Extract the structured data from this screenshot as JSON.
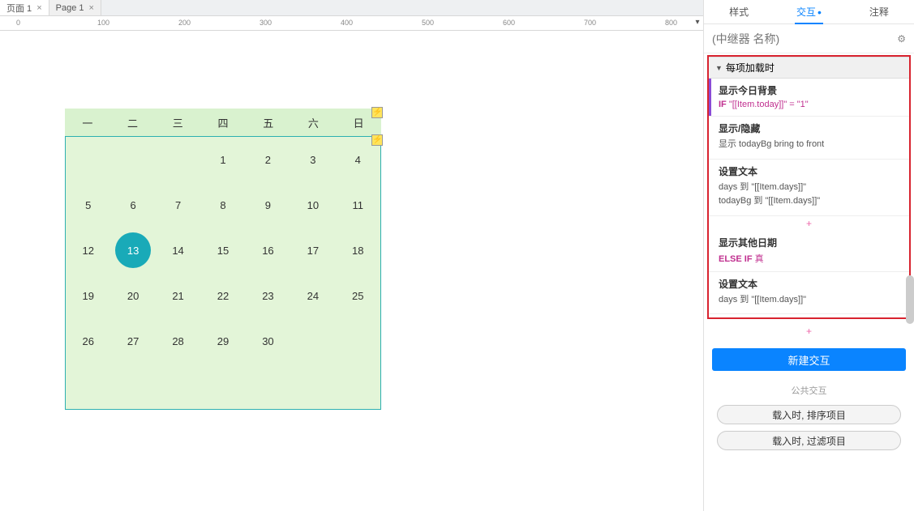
{
  "doc_tabs": [
    {
      "label": "页面 1",
      "active": true
    },
    {
      "label": "Page 1",
      "active": false
    }
  ],
  "ruler_ticks": [
    0,
    100,
    200,
    300,
    400,
    500,
    600,
    700,
    800
  ],
  "calendar": {
    "weekdays": [
      "一",
      "二",
      "三",
      "四",
      "五",
      "六",
      "日"
    ],
    "cells": [
      "",
      "",
      "",
      "1",
      "2",
      "3",
      "4",
      "5",
      "6",
      "7",
      "8",
      "9",
      "10",
      "11",
      "12",
      "13",
      "14",
      "15",
      "16",
      "17",
      "18",
      "19",
      "20",
      "21",
      "22",
      "23",
      "24",
      "25",
      "26",
      "27",
      "28",
      "29",
      "30",
      "",
      "",
      "",
      "",
      "",
      ""
    ],
    "today_index": 15
  },
  "panel": {
    "tabs": {
      "style": "样式",
      "interact": "交互",
      "notes": "注释"
    },
    "placeholder": "(中继器 名称)",
    "event": "每项加载时",
    "case1": {
      "title": "显示今日背景",
      "kw": "IF",
      "cond": "\"[[Item.today]]\" = \"1\""
    },
    "act1": {
      "title": "显示/隐藏",
      "line1": "显示 todayBg  bring to front"
    },
    "act2": {
      "title": "设置文本",
      "line1": "days 到 \"[[Item.days]]\"",
      "line2": "todayBg 到 \"[[Item.days]]\""
    },
    "case2": {
      "title": "显示其他日期",
      "kw": "ELSE IF",
      "cond": "真"
    },
    "act3": {
      "title": "设置文本",
      "line1": "days 到 \"[[Item.days]]\""
    },
    "new_ix": "新建交互",
    "shared": "公共交互",
    "pill1": "载入时, 排序项目",
    "pill2": "载入时, 过滤项目"
  }
}
